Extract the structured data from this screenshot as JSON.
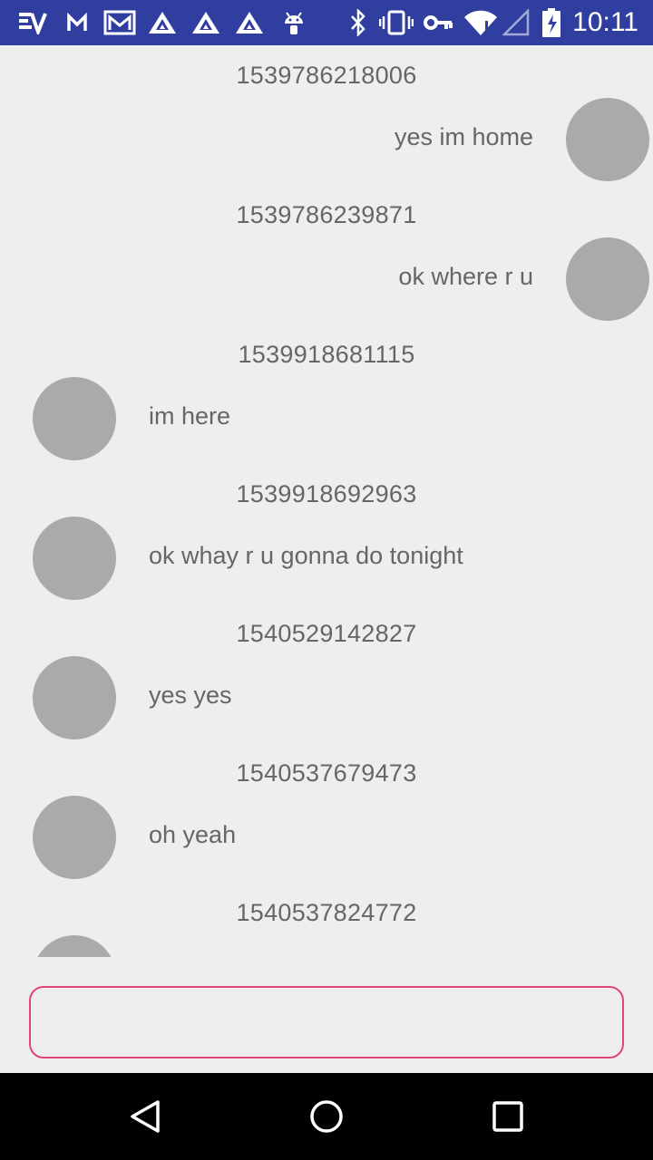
{
  "status_bar": {
    "time": "10:11",
    "background": "#303f9f",
    "icons_left": [
      "evernote-icon",
      "gmail-m-icon",
      "gmail-box-icon",
      "triangle-app-icon",
      "triangle-app-icon",
      "triangle-app-icon",
      "android-icon"
    ],
    "icons_right": [
      "bluetooth-icon",
      "vibrate-icon",
      "vpn-key-icon",
      "wifi-icon",
      "signal-icon",
      "battery-icon"
    ]
  },
  "messages": [
    {
      "timestamp": "1539786218006",
      "text": "yes im home",
      "side": "sent"
    },
    {
      "timestamp": "1539786239871",
      "text": "ok where r u",
      "side": "sent"
    },
    {
      "timestamp": "1539918681115",
      "text": "im here",
      "side": "recv"
    },
    {
      "timestamp": "1539918692963",
      "text": "ok whay r u gonna do tonight",
      "side": "recv"
    },
    {
      "timestamp": "1540529142827",
      "text": "yes yes",
      "side": "recv"
    },
    {
      "timestamp": "1540537679473",
      "text": "oh yeah",
      "side": "recv"
    },
    {
      "timestamp": "1540537824772",
      "text": "",
      "side": "recv"
    }
  ],
  "composer": {
    "value": "",
    "placeholder": "",
    "border_color": "#e0457b"
  },
  "nav_bar": {
    "buttons": [
      "back-icon",
      "home-icon",
      "recents-icon"
    ]
  },
  "colors": {
    "background": "#eeeeee",
    "avatar": "#aaaaaa",
    "text": "#666666"
  }
}
